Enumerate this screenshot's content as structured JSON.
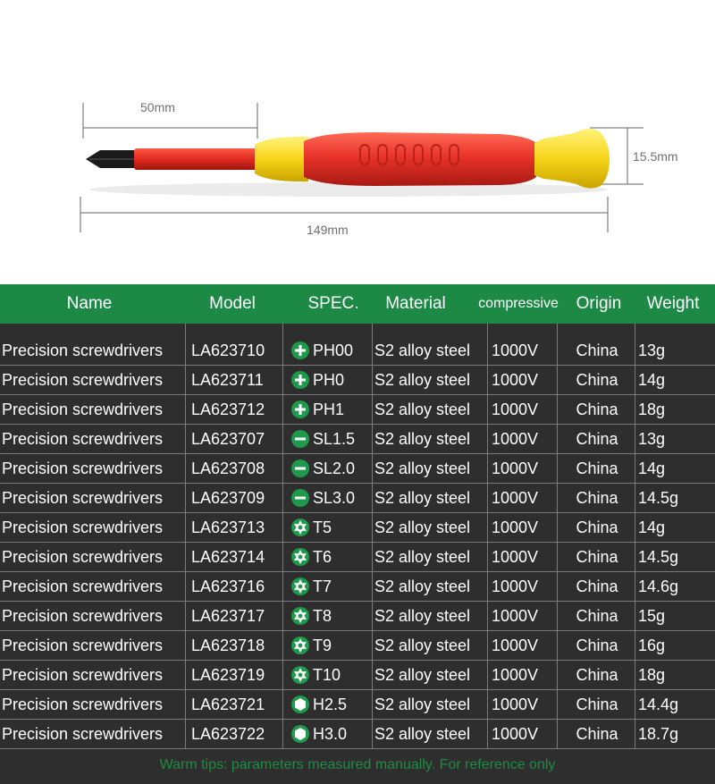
{
  "illustration": {
    "dim_shaft": "50mm",
    "dim_total": "149mm",
    "dim_diameter": "15.5mm",
    "colors": {
      "handle_red": "#e8332a",
      "handle_yellow": "#f7d519",
      "tip_black": "#1a1a1a"
    }
  },
  "table": {
    "header_color": "#1c8a45",
    "headers": {
      "name": "Name",
      "model": "Model",
      "spec": "SPEC.",
      "material": "Material",
      "compressive": "compressive",
      "origin": "Origin",
      "weight": "Weight"
    },
    "rows": [
      {
        "name": "Precision screwdrivers",
        "model": "LA623710",
        "icon": "phillips-icon",
        "spec": "PH00",
        "material": "S2 alloy steel",
        "voltage": "1000V",
        "origin": "China",
        "weight": "13g"
      },
      {
        "name": "Precision screwdrivers",
        "model": "LA623711",
        "icon": "phillips-icon",
        "spec": "PH0",
        "material": "S2 alloy steel",
        "voltage": "1000V",
        "origin": "China",
        "weight": "14g"
      },
      {
        "name": "Precision screwdrivers",
        "model": "LA623712",
        "icon": "phillips-icon",
        "spec": "PH1",
        "material": "S2 alloy steel",
        "voltage": "1000V",
        "origin": "China",
        "weight": "18g"
      },
      {
        "name": "Precision screwdrivers",
        "model": "LA623707",
        "icon": "slotted-icon",
        "spec": "SL1.5",
        "material": "S2 alloy steel",
        "voltage": "1000V",
        "origin": "China",
        "weight": "13g"
      },
      {
        "name": "Precision screwdrivers",
        "model": "LA623708",
        "icon": "slotted-icon",
        "spec": "SL2.0",
        "material": "S2 alloy steel",
        "voltage": "1000V",
        "origin": "China",
        "weight": "14g"
      },
      {
        "name": "Precision screwdrivers",
        "model": "LA623709",
        "icon": "slotted-icon",
        "spec": "SL3.0",
        "material": "S2 alloy steel",
        "voltage": "1000V",
        "origin": "China",
        "weight": "14.5g"
      },
      {
        "name": "Precision screwdrivers",
        "model": "LA623713",
        "icon": "torx-icon",
        "spec": "T5",
        "material": "S2 alloy steel",
        "voltage": "1000V",
        "origin": "China",
        "weight": "14g"
      },
      {
        "name": "Precision screwdrivers",
        "model": "LA623714",
        "icon": "torx-icon",
        "spec": "T6",
        "material": "S2 alloy steel",
        "voltage": "1000V",
        "origin": "China",
        "weight": "14.5g"
      },
      {
        "name": "Precision screwdrivers",
        "model": "LA623716",
        "icon": "torx-icon",
        "spec": "T7",
        "material": "S2 alloy steel",
        "voltage": "1000V",
        "origin": "China",
        "weight": "14.6g"
      },
      {
        "name": "Precision screwdrivers",
        "model": "LA623717",
        "icon": "torx-icon",
        "spec": "T8",
        "material": "S2 alloy steel",
        "voltage": "1000V",
        "origin": "China",
        "weight": "15g"
      },
      {
        "name": "Precision screwdrivers",
        "model": "LA623718",
        "icon": "torx-icon",
        "spec": "T9",
        "material": "S2 alloy steel",
        "voltage": "1000V",
        "origin": "China",
        "weight": "16g"
      },
      {
        "name": "Precision screwdrivers",
        "model": "LA623719",
        "icon": "torx-icon",
        "spec": "T10",
        "material": "S2 alloy steel",
        "voltage": "1000V",
        "origin": "China",
        "weight": "18g"
      },
      {
        "name": "Precision screwdrivers",
        "model": "LA623721",
        "icon": "hex-icon",
        "spec": "H2.5",
        "material": "S2 alloy steel",
        "voltage": "1000V",
        "origin": "China",
        "weight": "14.4g"
      },
      {
        "name": "Precision screwdrivers",
        "model": "LA623722",
        "icon": "hex-icon",
        "spec": "H3.0",
        "material": "S2 alloy steel",
        "voltage": "1000V",
        "origin": "China",
        "weight": "18.7g"
      }
    ]
  },
  "footer": {
    "tip": "Warm tips: parameters measured manually. For reference only"
  }
}
